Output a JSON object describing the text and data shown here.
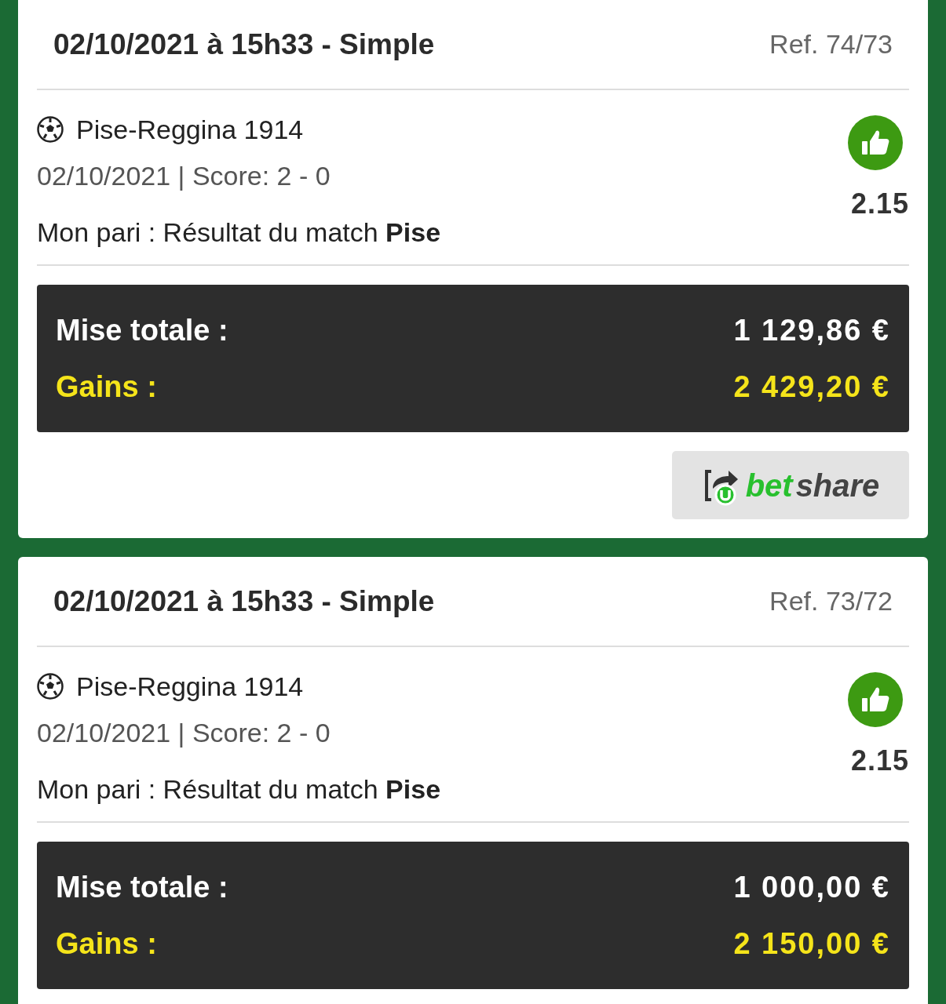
{
  "bets": [
    {
      "title": "02/10/2021 à 15h33 - Simple",
      "ref": "Ref. 74/73",
      "match": "Pise-Reggina 1914",
      "details": "02/10/2021 | Score: 2 - 0",
      "bet": "Mon pari : Résultat du match **Pise**",
      "won": true,
      "odds": "2.15",
      "stake_label": "Mise totale :",
      "stake": "1 129,86 €",
      "gains_label": "Gains :",
      "gains": "2 429,20 €",
      "share_button": {
        "brand_primary": "bet",
        "brand_secondary": "share"
      }
    },
    {
      "title": "02/10/2021 à 15h33 - Simple",
      "ref": "Ref. 73/72",
      "match": "Pise-Reggina 1914",
      "details": "02/10/2021 | Score: 2 - 0",
      "bet": "Mon pari : Résultat du match **Pise**",
      "won": true,
      "odds": "2.15",
      "stake_label": "Mise totale :",
      "stake": "1 000,00 €",
      "gains_label": "Gains :",
      "gains": "2 150,00 €"
    }
  ]
}
